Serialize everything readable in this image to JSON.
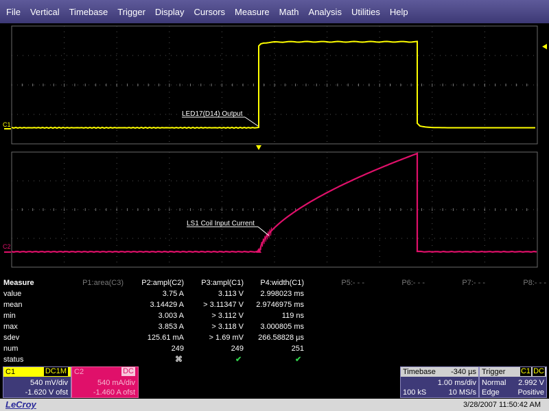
{
  "menu": [
    "File",
    "Vertical",
    "Timebase",
    "Trigger",
    "Display",
    "Cursors",
    "Measure",
    "Math",
    "Analysis",
    "Utilities",
    "Help"
  ],
  "traces": {
    "c1": {
      "marker": "C1",
      "annotation": "LED17(D14) Output",
      "color": "#ffff00"
    },
    "c2": {
      "marker": "C2",
      "annotation": "LS1 Coil Input Current",
      "color": "#e0106a"
    }
  },
  "measure": {
    "title": "Measure",
    "columns": [
      {
        "header": "P1:area(C3)",
        "active": false
      },
      {
        "header": "P2:ampl(C2)",
        "active": true
      },
      {
        "header": "P3:ampl(C1)",
        "active": true
      },
      {
        "header": "P4:width(C1)",
        "active": true
      },
      {
        "header": "P5:- - -",
        "active": false
      },
      {
        "header": "P6:- - -",
        "active": false
      },
      {
        "header": "P7:- - -",
        "active": false
      },
      {
        "header": "P8:- - -",
        "active": false
      }
    ],
    "row_labels": [
      "value",
      "mean",
      "min",
      "max",
      "sdev",
      "num",
      "status"
    ],
    "p2": [
      "3.75 A",
      "3.14429 A",
      "3.003 A",
      "3.853 A",
      "125.61 mA",
      "249"
    ],
    "p3": [
      "3.113 V",
      "> 3.11347 V",
      "> 3.112 V",
      "> 3.118 V",
      "> 1.69 mV",
      "249"
    ],
    "p4": [
      "2.998023 ms",
      "2.9746975 ms",
      "119 ns",
      "3.000805 ms",
      "266.58828 µs",
      "251"
    ]
  },
  "channels": {
    "c1": {
      "label": "C1",
      "coupling": "DC1M",
      "vdiv": "540 mV/div",
      "offset": "-1.620 V ofst"
    },
    "c2": {
      "label": "C2",
      "coupling": "DC",
      "vdiv": "540 mA/div",
      "offset": "-1.460 A ofst"
    }
  },
  "timebase": {
    "label": "Timebase",
    "delay": "-340 µs",
    "tdiv": "1.00 ms/div",
    "samples": "100 kS",
    "rate": "10 MS/s"
  },
  "trigger": {
    "label": "Trigger",
    "source": "C1",
    "coupling": "DC",
    "mode": "Normal",
    "level": "2.992 V",
    "type": "Edge",
    "slope": "Positive"
  },
  "brand": "LeCroy",
  "datetime": "3/28/2007 11:50:42 AM",
  "colors": {
    "c1": "#ffff00",
    "c2": "#e0106a",
    "menubar": "#4a4686",
    "grid": "#6a6a6a"
  }
}
